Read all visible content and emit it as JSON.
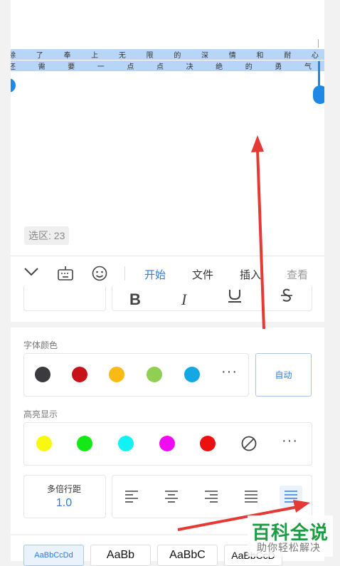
{
  "document": {
    "line1": [
      "除",
      "了",
      "奉",
      "上",
      "无",
      "限",
      "的",
      "深",
      "情",
      "和",
      "耐",
      "心"
    ],
    "line2": [
      "还",
      "需",
      "要",
      "一",
      "点",
      "点",
      "决",
      "绝",
      "的",
      "勇",
      "气"
    ],
    "selection_count": "选区: 23"
  },
  "toolbar": {
    "tabs": [
      {
        "label": "开始"
      },
      {
        "label": "文件"
      },
      {
        "label": "插入"
      },
      {
        "label": "查看"
      }
    ]
  },
  "font_color": {
    "label": "字体颜色",
    "swatches": [
      "#3a3a3f",
      "#c8121a",
      "#f9bb13",
      "#8fcf53",
      "#13a7e3"
    ],
    "auto_label": "自动",
    "more": "···"
  },
  "highlight": {
    "label": "高亮显示",
    "swatches": [
      "#f8f90e",
      "#15e817",
      "#13f2f3",
      "#f00cf0",
      "#ec1010"
    ],
    "more": "···"
  },
  "line_spacing": {
    "label": "多倍行距",
    "value": "1.0"
  },
  "styles": [
    "AaBbCcDd",
    "AaBb",
    "AaBbC",
    "AaBbCcD"
  ],
  "watermark": {
    "title": "百科全说",
    "subtitle": "助你轻松解决"
  },
  "colors": {
    "accent": "#2f7be0",
    "selection": "#b7d6f7",
    "arrow": "#e53935"
  }
}
